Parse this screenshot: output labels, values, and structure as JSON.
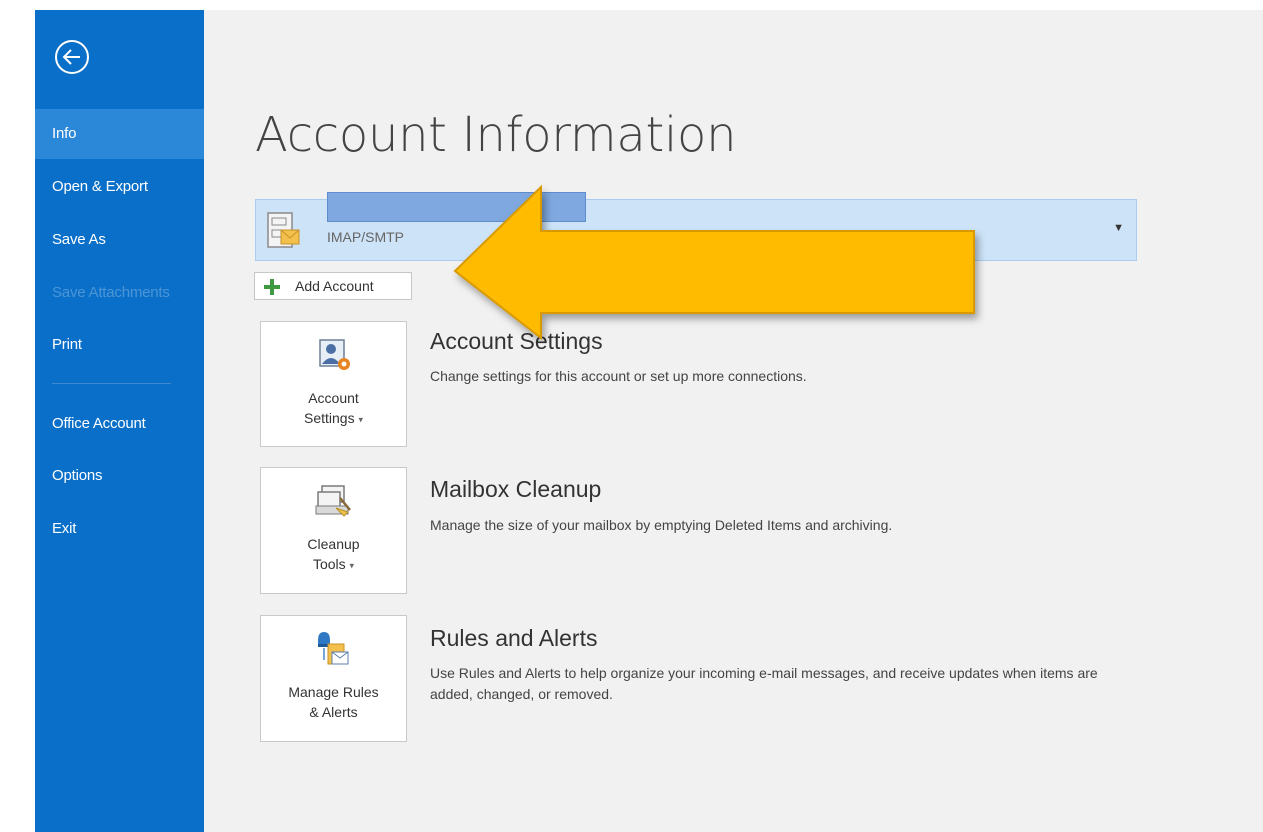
{
  "sidebar": {
    "items": [
      {
        "label": "Info"
      },
      {
        "label": "Open & Export"
      },
      {
        "label": "Save As"
      },
      {
        "label": "Save Attachments"
      },
      {
        "label": "Print"
      },
      {
        "label": "Office Account"
      },
      {
        "label": "Options"
      },
      {
        "label": "Exit"
      }
    ],
    "active_item": "Info",
    "disabled_item": "Save Attachments"
  },
  "main": {
    "title": "Account Information",
    "account": {
      "type": "IMAP/SMTP"
    },
    "add_account_label": "Add Account",
    "sections": [
      {
        "button_line1": "Account",
        "button_line2": "Settings",
        "title": "Account Settings",
        "description": "Change settings for this account or set up more connections."
      },
      {
        "button_line1": "Cleanup",
        "button_line2": "Tools",
        "title": "Mailbox Cleanup",
        "description": "Manage the size of your mailbox by emptying Deleted Items and archiving."
      },
      {
        "button_line1": "Manage Rules",
        "button_line2": "& Alerts",
        "title": "Rules and Alerts",
        "description": "Use Rules and Alerts to help organize your incoming e-mail messages, and receive updates when items are added, changed, or removed."
      }
    ]
  },
  "colors": {
    "sidebar_bg": "#0a6fc8",
    "sidebar_active": "#2b88d8",
    "main_bg": "#f1f1f1",
    "account_bg": "#cde3f7",
    "arrow": "#ffbb00"
  },
  "icons": {
    "back": "back-arrow-icon",
    "account_card": "account-card-icon",
    "add": "plus-icon",
    "account_settings": "account-settings-icon",
    "cleanup": "cleanup-tools-icon",
    "rules": "rules-alerts-icon",
    "callout": "callout-arrow-icon"
  }
}
